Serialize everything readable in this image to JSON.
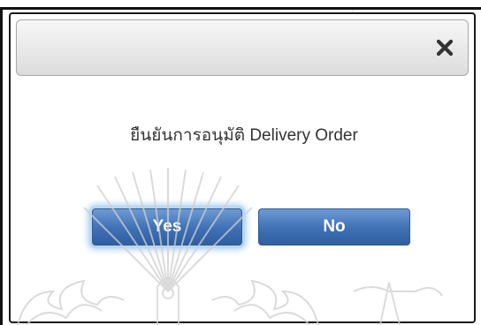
{
  "dialog": {
    "message": "ยืนยันการอนุมัติ Delivery Order",
    "close_icon": "close-icon",
    "yes_label": "Yes",
    "no_label": "No"
  },
  "colors": {
    "button_blue": "#3f70b5",
    "focus_glow": "#9cc7f0",
    "header_gray": "#dcdcdc",
    "text": "#333333"
  }
}
